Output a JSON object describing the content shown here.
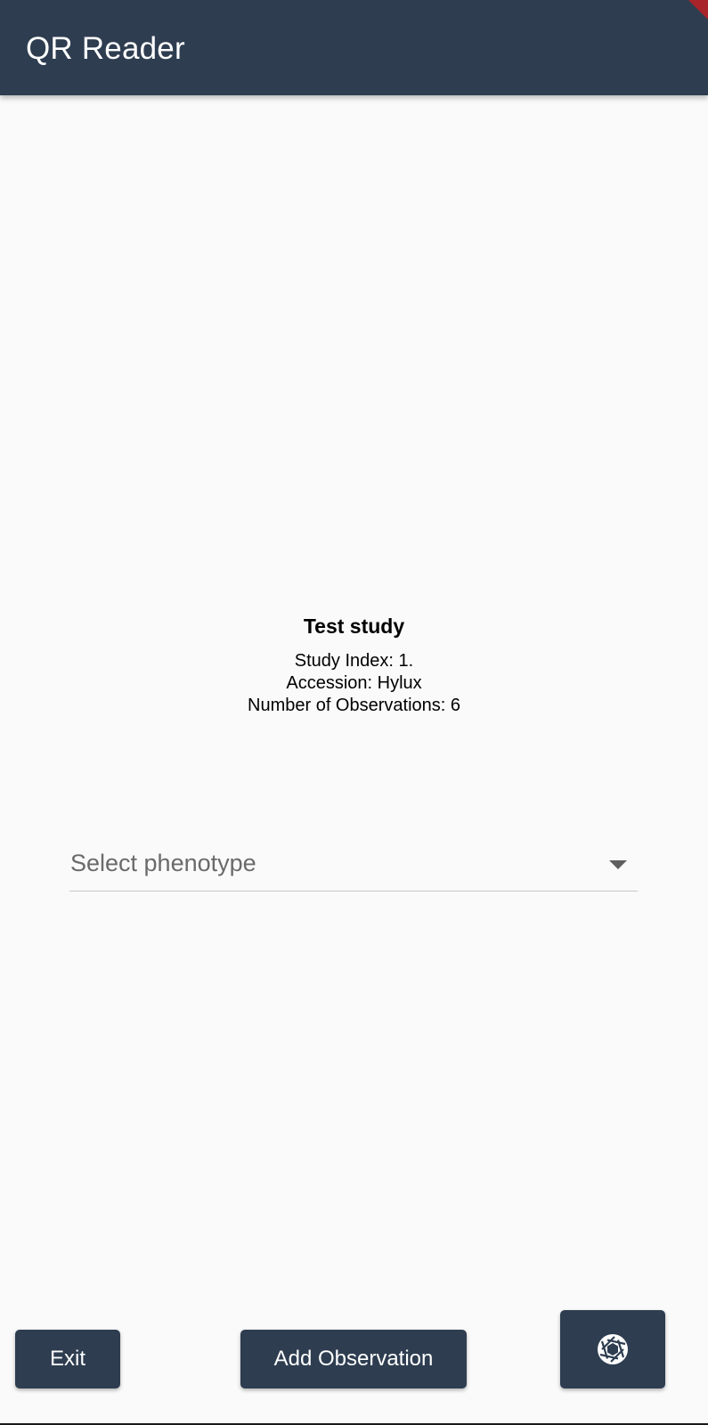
{
  "appbar": {
    "title": "QR Reader",
    "color": "#2e3d50"
  },
  "study": {
    "title": "Test study",
    "index_line": "Study Index: 1.",
    "accession_line": "Accession: Hylux",
    "observations_line": "Number of Observations: 6"
  },
  "phenotype_dropdown": {
    "placeholder": "Select phenotype",
    "icon": "arrow-drop-down-icon"
  },
  "buttons": {
    "exit_label": "Exit",
    "add_observation_label": "Add Observation",
    "camera_icon": "camera-shutter-icon"
  }
}
